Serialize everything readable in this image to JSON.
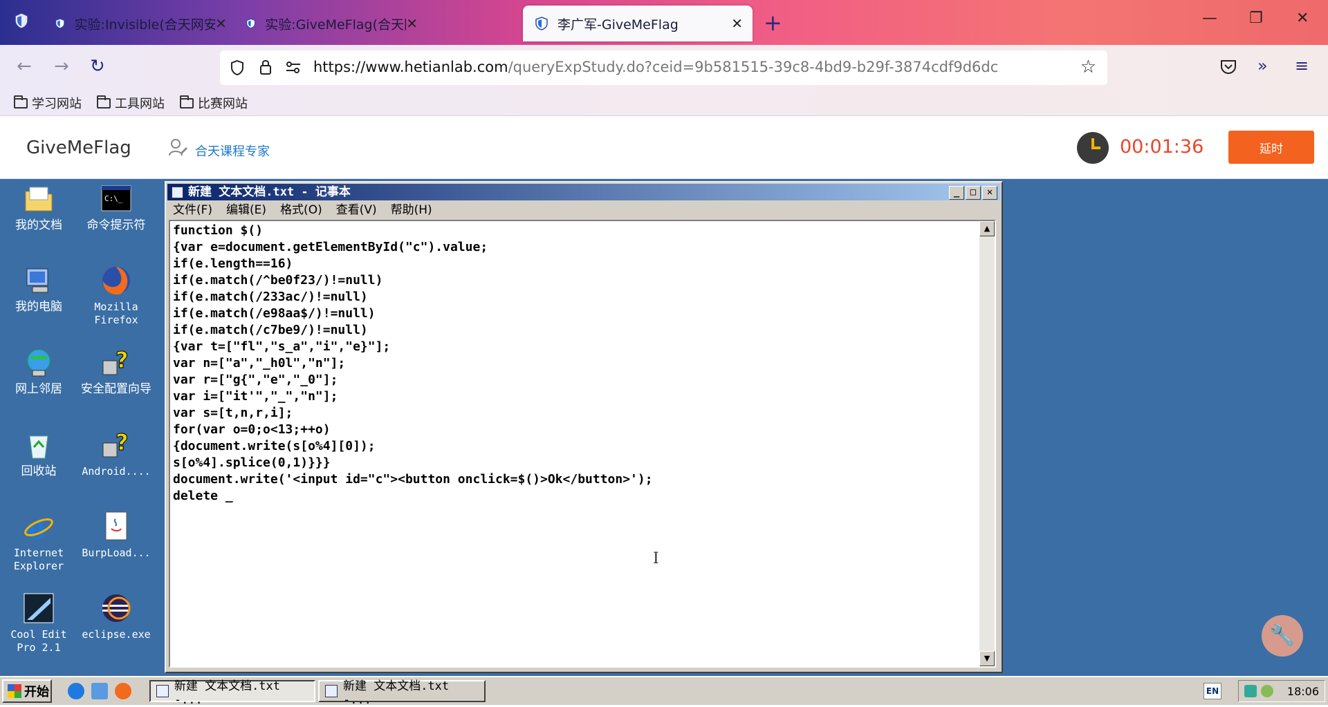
{
  "browser": {
    "tabs": [
      {
        "label": "实验:Invisible(合天网安实验室)",
        "active": false
      },
      {
        "label": "实验:GiveMeFlag(合天网安实验",
        "active": false
      },
      {
        "label": "李广军-GiveMeFlag",
        "active": true
      }
    ],
    "new_tab_symbol": "+",
    "url_host": "https://www.hetianlab.com",
    "url_path": "/queryExpStudy.do?ceid=9b581515-39c8-4bd9-b29f-3874cdf9d6dc",
    "bookmarks": [
      "学习网站",
      "工具网站",
      "比赛网站"
    ]
  },
  "site": {
    "title": "GiveMeFlag",
    "user": "合天课程专家",
    "timer": "00:01:36",
    "extend_label": "延时",
    "accent_color": "#f4621f",
    "timer_color": "#e8462d"
  },
  "desktop": {
    "icons": [
      {
        "label": "我的文档",
        "icon": "folder-icon"
      },
      {
        "label": "命令提示符",
        "icon": "terminal-icon"
      },
      {
        "label": "我的电脑",
        "icon": "computer-icon"
      },
      {
        "label": "Mozilla Firefox",
        "icon": "firefox-icon"
      },
      {
        "label": "网上邻居",
        "icon": "network-icon"
      },
      {
        "label": "安全配置向导",
        "icon": "wizard-icon"
      },
      {
        "label": "回收站",
        "icon": "recycle-bin-icon"
      },
      {
        "label": "Android....",
        "icon": "wizard-icon"
      },
      {
        "label": "Internet Explorer",
        "icon": "ie-icon"
      },
      {
        "label": "BurpLoad...",
        "icon": "java-icon"
      },
      {
        "label": "Cool Edit Pro 2.1",
        "icon": "cooledit-icon"
      },
      {
        "label": "eclipse.exe",
        "icon": "eclipse-icon"
      }
    ]
  },
  "notepad": {
    "title": "新建 文本文档.txt - 记事本",
    "menu": [
      "文件(F)",
      "编辑(E)",
      "格式(O)",
      "查看(V)",
      "帮助(H)"
    ],
    "content": "function $()\n{var e=document.getElementById(\"c\").value;\nif(e.length==16)\nif(e.match(/^be0f23/)!=null)\nif(e.match(/233ac/)!=null)\nif(e.match(/e98aa$/)!=null)\nif(e.match(/c7be9/)!=null)\n{var t=[\"fl\",\"s_a\",\"i\",\"e}\"];\nvar n=[\"a\",\"_h0l\",\"n\"];\nvar r=[\"g{\",\"e\",\"_0\"];\nvar i=[\"it'\",\"_\",\"n\"];\nvar s=[t,n,r,i];\nfor(var o=0;o<13;++o)\n{document.write(s[o%4][0]);\ns[o%4].splice(0,1)}}}\ndocument.write('<input id=\"c\"><button onclick=$()>Ok</button>');\ndelete _"
  },
  "taskbar": {
    "start_label": "开始",
    "tasks": [
      "新建 文本文档.txt -...",
      "新建 文本文档.txt -..."
    ],
    "lang": "EN",
    "clock": "18:06"
  }
}
